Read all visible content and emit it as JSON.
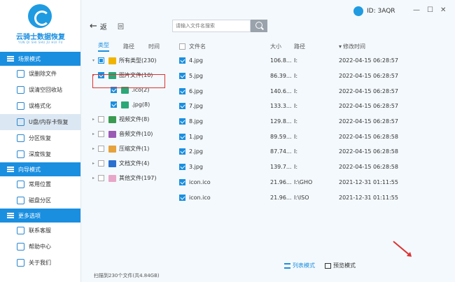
{
  "app": {
    "logo_text": "云骑士数据恢复",
    "logo_sub": "YUN QI SHI SHU JU HUI FU",
    "id_label": "ID: 3AQR",
    "win_min": "—",
    "win_max": "☐",
    "win_close": "✕"
  },
  "sidebar": {
    "sections": [
      {
        "title": "场景模式",
        "items": [
          "误删除文件",
          "误清空回收站",
          "误格式化",
          "U盘/内存卡恢复",
          "分区恢复",
          "深度恢复"
        ]
      },
      {
        "title": "向导模式",
        "items": [
          "常用位置",
          "磁盘分区"
        ]
      },
      {
        "title": "更多选项",
        "items": [
          "联系客服",
          "帮助中心",
          "关于我们"
        ]
      }
    ],
    "active_item": "U盘/内存卡恢复"
  },
  "toolbar": {
    "back_label": "返",
    "home_label": "回",
    "search_placeholder": "请输入文件名搜索"
  },
  "tree": {
    "tabs": [
      "类型",
      "路径",
      "时间"
    ],
    "rows": [
      {
        "label": "所有类型(230)",
        "toggle": "▾",
        "check": "part",
        "color": "#f0b400"
      },
      {
        "label": "图片文件(10)",
        "toggle": "▾",
        "check": "on",
        "color": "#2aa878"
      },
      {
        "label": ".ico(2)",
        "toggle": "",
        "check": "on",
        "color": "#2aa878"
      },
      {
        "label": ".jpg(8)",
        "toggle": "",
        "check": "on",
        "color": "#2aa878"
      },
      {
        "label": "视频文件(8)",
        "toggle": "▸",
        "check": "off",
        "color": "#3a9a50"
      },
      {
        "label": "音频文件(10)",
        "toggle": "▸",
        "check": "off",
        "color": "#9b59b6"
      },
      {
        "label": "压缩文件(1)",
        "toggle": "▸",
        "check": "off",
        "color": "#e6a23c"
      },
      {
        "label": "文档文件(4)",
        "toggle": "▸",
        "check": "off",
        "color": "#2b6fd1"
      },
      {
        "label": "其他文件(197)",
        "toggle": "▸",
        "check": "off",
        "color": "#e8a7c8"
      }
    ]
  },
  "table": {
    "headers": {
      "name": "文件名",
      "size": "大小",
      "path": "路径",
      "time": "修改时间"
    },
    "rows": [
      {
        "name": "4.jpg",
        "size": "106.8...",
        "path": "I:",
        "time": "2022-04-15 06:28:57"
      },
      {
        "name": "5.jpg",
        "size": "86.39...",
        "path": "I:",
        "time": "2022-04-15 06:28:57"
      },
      {
        "name": "6.jpg",
        "size": "140.6...",
        "path": "I:",
        "time": "2022-04-15 06:28:57"
      },
      {
        "name": "7.jpg",
        "size": "133.3...",
        "path": "I:",
        "time": "2022-04-15 06:28:57"
      },
      {
        "name": "8.jpg",
        "size": "129.8...",
        "path": "I:",
        "time": "2022-04-15 06:28:57"
      },
      {
        "name": "1.jpg",
        "size": "89.59...",
        "path": "I:",
        "time": "2022-04-15 06:28:58"
      },
      {
        "name": "2.jpg",
        "size": "87.74...",
        "path": "I:",
        "time": "2022-04-15 06:28:58"
      },
      {
        "name": "3.jpg",
        "size": "139.7...",
        "path": "I:",
        "time": "2022-04-15 06:28:58"
      },
      {
        "name": "icon.ico",
        "size": "21.96...",
        "path": "I:\\GHO",
        "time": "2021-12-31 01:11:55"
      },
      {
        "name": "icon.ico",
        "size": "21.96...",
        "path": "I:\\ISO",
        "time": "2021-12-31 01:11:55"
      }
    ]
  },
  "footer": {
    "status": "扫描到230个文件(共4.84GB)",
    "list_mode": "列表模式",
    "preview_mode": "预览模式"
  }
}
